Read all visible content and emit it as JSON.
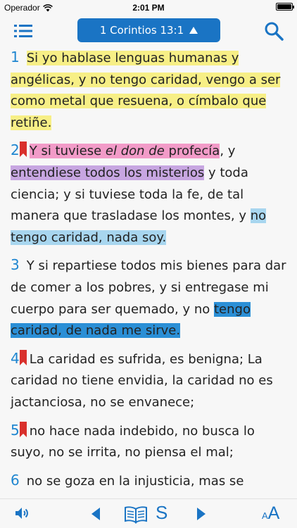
{
  "status_bar": {
    "carrier": "Operador",
    "time": "2:01 PM"
  },
  "nav": {
    "reference": "1 Corintios 13:1"
  },
  "verses": {
    "v1": {
      "number": "1",
      "t1": "Si yo hablase lenguas humanas y angélicas, y no tengo caridad, vengo a ser como metal que resuena, o címbalo que retiñe."
    },
    "v2": {
      "number": "2",
      "t1": "Y si tuviese ",
      "t2": "el don de",
      "t3": " profecía",
      "t4": ", y ",
      "t5": "entendiese todos los misterios",
      "t6": " y toda ciencia; y si tuviese toda la fe, de tal manera que trasladase los montes, y ",
      "t7": "no tengo caridad, nada soy."
    },
    "v3": {
      "number": "3",
      "t1": "Y si repartiese todos mis bienes para dar de comer a los pobres, y si entregase mi cuerpo para ser quemado, y no ",
      "t2": "tengo caridad, de nada me sirve."
    },
    "v4": {
      "number": "4",
      "t1": "La caridad es sufrida, es benigna; La caridad no tiene envidia, la caridad no es jactanciosa, no se envanece;"
    },
    "v5": {
      "number": "5",
      "t1": "no hace nada indebido, no busca lo suyo, no se irrita, no piensa el mal;"
    },
    "v6": {
      "number": "6",
      "t1": "no se goza en la injusticia, mas se"
    }
  },
  "toolbar": {
    "strong_label": "S",
    "font_small": "A",
    "font_big": "A"
  },
  "colors": {
    "accent": "#1a74c4",
    "highlight_yellow": "#f7ef86",
    "highlight_pink": "#f29bc8",
    "highlight_purple": "#c7a6e1",
    "highlight_lightblue": "#a8d6ef",
    "highlight_blue": "#2b8fd6",
    "bookmark": "#d9302c"
  }
}
